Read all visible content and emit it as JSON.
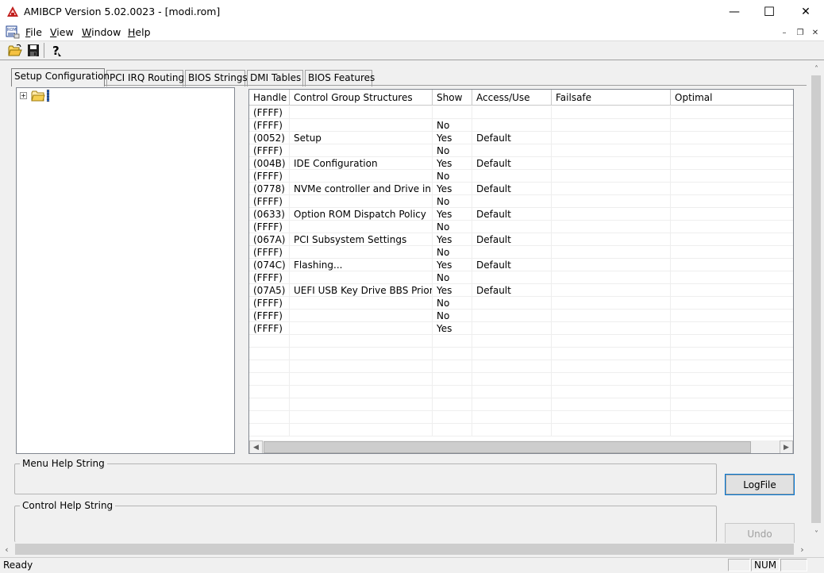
{
  "window": {
    "title": "AMIBCP Version 5.02.0023 - [modi.rom]",
    "minimize": "—",
    "maximize": "☐",
    "close": "✕"
  },
  "menu": {
    "items": [
      "File",
      "View",
      "Window",
      "Help"
    ],
    "mdi_minimize": "–",
    "mdi_restore": "❐",
    "mdi_close": "✕"
  },
  "toolbar": {
    "icons": [
      "open-folder-icon",
      "save-icon",
      "help-question-icon"
    ]
  },
  "tabs": [
    {
      "label": "Setup Configuration",
      "active": true
    },
    {
      "label": "PCI IRQ Routing",
      "active": false
    },
    {
      "label": "BIOS Strings",
      "active": false
    },
    {
      "label": "DMI Tables",
      "active": false
    },
    {
      "label": "BIOS Features",
      "active": false
    }
  ],
  "tree": {
    "expander": "+"
  },
  "grid": {
    "columns": [
      "Handle",
      "Control Group Structures",
      "Show",
      "Access/Use",
      "Failsafe",
      "Optimal"
    ],
    "rows": [
      [
        "(FFFF)",
        "",
        "",
        "",
        "",
        ""
      ],
      [
        "(FFFF)",
        "",
        "No",
        "",
        "",
        ""
      ],
      [
        "(0052)",
        "Setup",
        "Yes",
        "Default",
        "",
        ""
      ],
      [
        "(FFFF)",
        "",
        "No",
        "",
        "",
        ""
      ],
      [
        "(004B)",
        "IDE Configuration",
        "Yes",
        "Default",
        "",
        ""
      ],
      [
        "(FFFF)",
        "",
        "No",
        "",
        "",
        ""
      ],
      [
        "(0778)",
        "NVMe controller and Drive in...",
        "Yes",
        "Default",
        "",
        ""
      ],
      [
        "(FFFF)",
        "",
        "No",
        "",
        "",
        ""
      ],
      [
        "(0633)",
        "Option ROM Dispatch Policy",
        "Yes",
        "Default",
        "",
        ""
      ],
      [
        "(FFFF)",
        "",
        "No",
        "",
        "",
        ""
      ],
      [
        "(067A)",
        "PCI Subsystem Settings",
        "Yes",
        "Default",
        "",
        ""
      ],
      [
        "(FFFF)",
        "",
        "No",
        "",
        "",
        ""
      ],
      [
        "(074C)",
        "Flashing...",
        "Yes",
        "Default",
        "",
        ""
      ],
      [
        "(FFFF)",
        "",
        "No",
        "",
        "",
        ""
      ],
      [
        "(07A5)",
        "UEFI USB Key Drive BBS Prior...",
        "Yes",
        "Default",
        "",
        ""
      ],
      [
        "(FFFF)",
        "",
        "No",
        "",
        "",
        ""
      ],
      [
        "(FFFF)",
        "",
        "No",
        "",
        "",
        ""
      ],
      [
        "(FFFF)",
        "",
        "Yes",
        "",
        "",
        ""
      ]
    ]
  },
  "help": {
    "menu_help_label": "Menu Help String",
    "control_help_label": "Control Help String"
  },
  "buttons": {
    "logfile": "LogFile",
    "undo": "Undo"
  },
  "status": {
    "text": "Ready",
    "num": "NUM"
  },
  "colors": {
    "accent_focus": "#0078d7",
    "window_bg": "#f0f0f0",
    "grid_bg": "#ffffff"
  }
}
